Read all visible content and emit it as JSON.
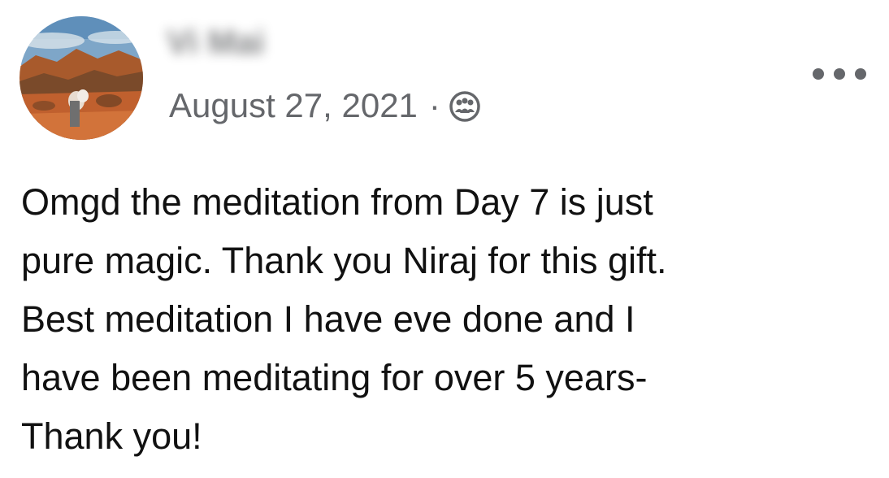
{
  "post": {
    "author_name": "Vi Mai",
    "date": "August 27, 2021",
    "separator": "·",
    "audience_icon": "friends-icon",
    "more_icon": "more-options-icon",
    "text_lines": [
      "Omgd the meditation from Day 7 is just",
      "pure magic. Thank you Niraj for this gift.",
      "Best meditation I have eve done and I",
      "have been meditating for over 5 years-",
      "Thank you!"
    ]
  },
  "colors": {
    "text_primary": "#111111",
    "text_secondary": "#65676b",
    "background": "#ffffff"
  }
}
